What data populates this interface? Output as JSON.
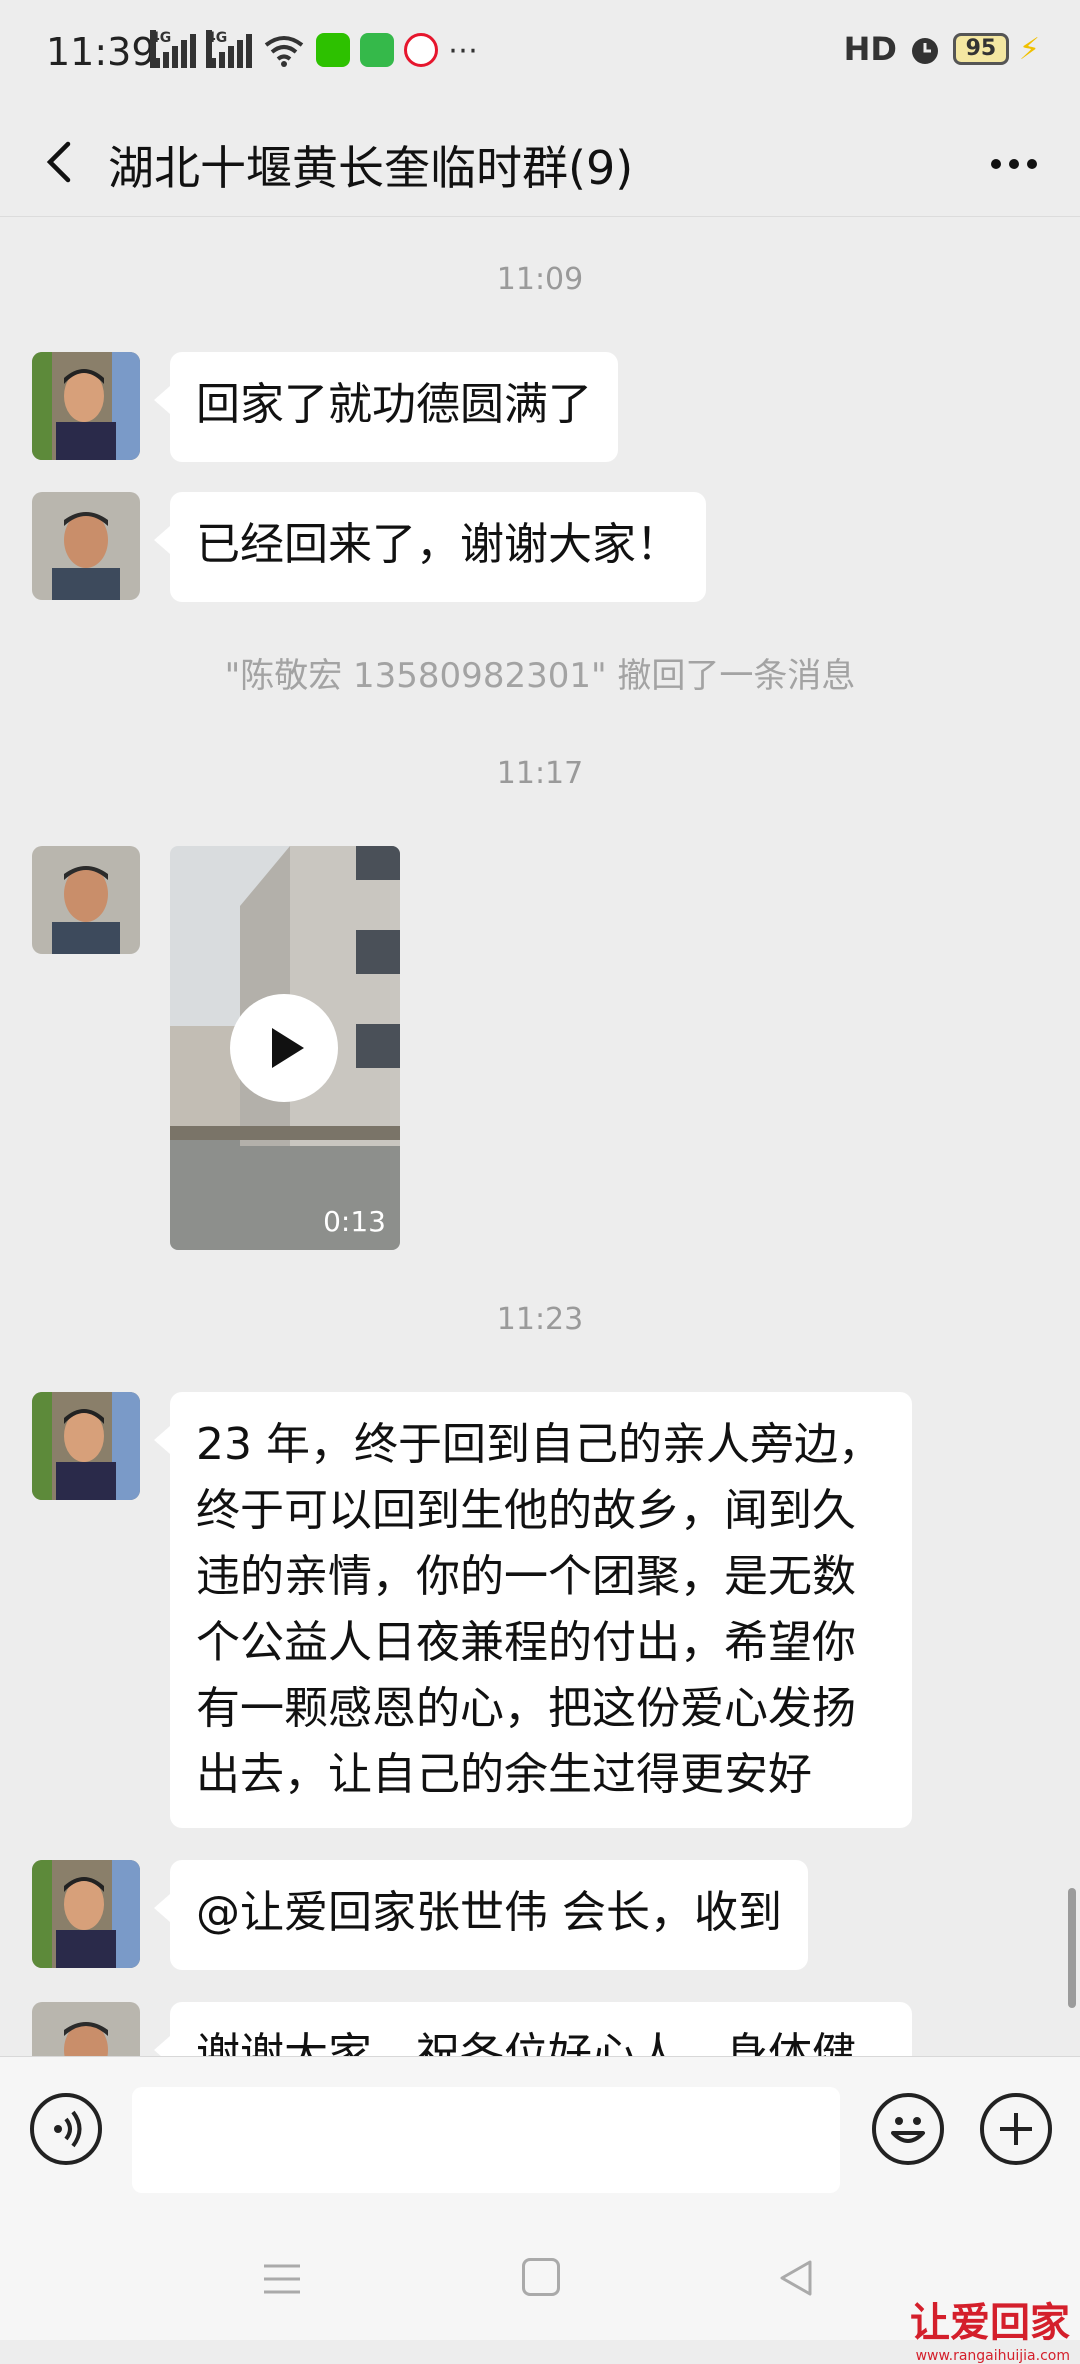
{
  "status_bar": {
    "time": "11:39",
    "network_1": "4G",
    "network_2": "4G",
    "hd_label": "HD",
    "battery": "95",
    "icons": [
      "signal-icon",
      "signal-icon",
      "wifi-icon",
      "wechat-icon",
      "message-icon",
      "weibo-icon",
      "more-dots-icon",
      "alarm-icon",
      "battery-icon",
      "charging-icon"
    ]
  },
  "header": {
    "title": "湖北十堰黄长奎临时群(9)"
  },
  "messages": {
    "ts1": "11:09",
    "m1": "回家了就功德圆满了",
    "m2": "已经回来了，谢谢大家！",
    "recall": "\"陈敬宏 13580982301\" 撤回了一条消息",
    "ts2": "11:17",
    "video_duration": "0:13",
    "ts3": "11:23",
    "m3_lines": [
      "23 年，终于回到自己的亲人旁边，",
      "终于可以回到生他的故乡，闻到久",
      "违的亲情，你的一个团聚，是无数",
      "个公益人日夜兼程的付出，希望你",
      "有一颗感恩的心，把这份爱心发扬",
      "出去，让自己的余生过得更安好"
    ],
    "m4": "@让爱回家张世伟  会长，收到",
    "m5_partial": "谢谢大家，祝各位好心人，身体健"
  },
  "input": {
    "value": "",
    "placeholder": ""
  },
  "watermark": {
    "title": "让爱回家",
    "url": "www.rangaihuijia.com"
  },
  "colors": {
    "background": "#ededed",
    "bubble": "#ffffff",
    "meta_text": "#9a9a9a",
    "wechat_green": "#2dc100",
    "weibo_red": "#e6162d",
    "watermark_red": "#d41f2b"
  }
}
